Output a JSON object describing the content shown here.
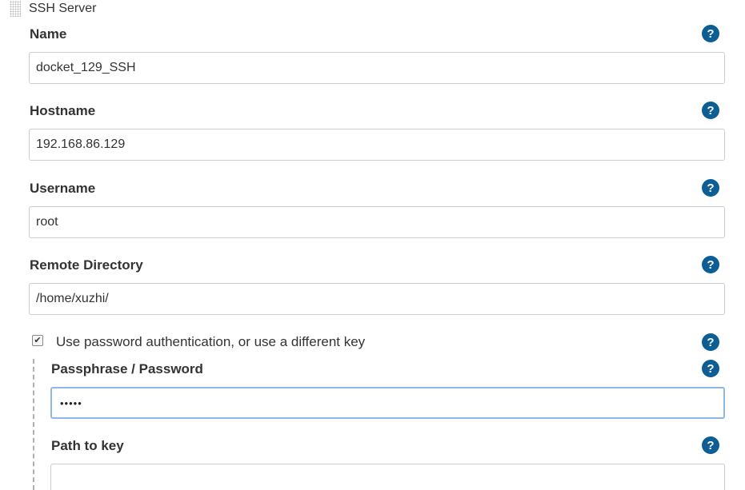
{
  "section": {
    "title": "SSH Server",
    "drag_icon": "drag-handle-icon"
  },
  "help_glyph": "?",
  "fields": {
    "name": {
      "label": "Name",
      "value": "docket_129_SSH"
    },
    "hostname": {
      "label": "Hostname",
      "value": "192.168.86.129"
    },
    "username": {
      "label": "Username",
      "value": "root"
    },
    "remote_directory": {
      "label": "Remote Directory",
      "value": "/home/xuzhi/"
    },
    "use_password": {
      "label": "Use password authentication, or use a different key",
      "checked": true
    },
    "passphrase": {
      "label": "Passphrase / Password",
      "masked_value": "•••••"
    },
    "path_to_key": {
      "label": "Path to key",
      "value": ""
    }
  },
  "colors": {
    "help_icon_bg": "#0c5e94",
    "input_border": "#cccccc",
    "focus_border": "#8fb8de",
    "text": "#333333"
  }
}
